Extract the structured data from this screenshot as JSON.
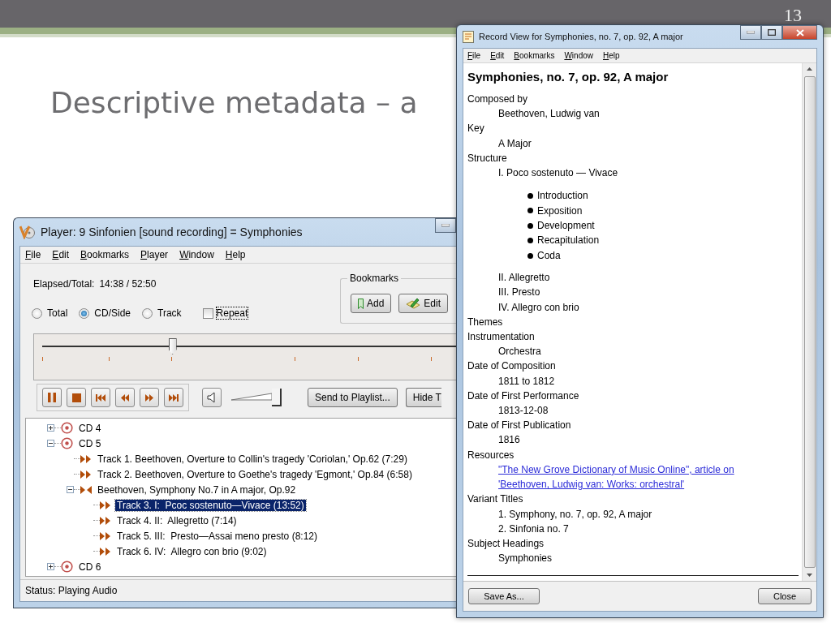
{
  "slide": {
    "title": "Descriptive metadata – a",
    "number": "13"
  },
  "player": {
    "title": "Player: 9 Sinfonien [sound recording] = Symphonies",
    "menu": [
      "File",
      "Edit",
      "Bookmarks",
      "Player",
      "Window",
      "Help"
    ],
    "elapsed_label": "Elapsed/Total:",
    "elapsed_value": "14:38 / 52:50",
    "time_modes": [
      {
        "label": "Total",
        "selected": false
      },
      {
        "label": "CD/Side",
        "selected": true
      },
      {
        "label": "Track",
        "selected": false
      }
    ],
    "repeat": {
      "label": "Repeat",
      "checked": false
    },
    "bookmarks": {
      "title": "Bookmarks",
      "buttons": [
        {
          "label": "Add",
          "kind": "add"
        },
        {
          "label": "Edit",
          "kind": "edit"
        }
      ]
    },
    "position": {
      "level": 0.315
    },
    "volume": {
      "level": 1
    },
    "buttons": [
      "Send to Playlist...",
      "Hide T"
    ],
    "tree": [
      {
        "label": "CD 4",
        "kind": "disc",
        "expanded": false,
        "selected": false
      },
      {
        "label": "CD 5",
        "kind": "disc",
        "expanded": true,
        "selected": false,
        "children": [
          {
            "label": "Track 1. Beethoven, Overture to Collin's tragedy 'Coriolan,' Op.62 (7:29)",
            "kind": "track",
            "selected": false
          },
          {
            "label": "Track 2. Beethoven, Overture to Goethe's tragedy 'Egmont,' Op.84 (6:58)",
            "kind": "track",
            "selected": false
          },
          {
            "label": "Beethoven, Symphony No.7 in A major, Op.92",
            "kind": "work",
            "expanded": true,
            "selected": false,
            "children": [
              {
                "label": "Track 3. I:  Pcoc sostenuto—Vivace (13:52)",
                "kind": "track",
                "selected": true
              },
              {
                "label": "Track 4. II:  Allegretto (7:14)",
                "kind": "track",
                "selected": false
              },
              {
                "label": "Track 5. III:  Presto—Assai meno presto (8:12)",
                "kind": "track",
                "selected": false
              },
              {
                "label": "Track 6. IV:  Allegro con brio (9:02)",
                "kind": "track",
                "selected": false
              }
            ]
          }
        ]
      },
      {
        "label": "CD 6",
        "kind": "disc",
        "expanded": false,
        "selected": false
      }
    ],
    "status": "Status: Playing Audio"
  },
  "record": {
    "title": "Record View for Symphonies, no. 7, op. 92, A major",
    "menu": [
      "File",
      "Edit",
      "Bookmarks",
      "Window",
      "Help"
    ],
    "heading": "Symphonies, no. 7, op. 92, A major",
    "fields": [
      {
        "label": "Composed by",
        "values": [
          {
            "text": "Beethoven, Ludwig van",
            "kind": "text"
          }
        ]
      },
      {
        "label": "Key",
        "values": [
          {
            "text": "A Major",
            "kind": "text"
          }
        ]
      },
      {
        "label": "Structure",
        "values": [
          {
            "text": "I. Poco sostenuto — Vivace",
            "kind": "text",
            "children": [
              {
                "text": "Introduction"
              },
              {
                "text": "Exposition"
              },
              {
                "text": "Development"
              },
              {
                "text": "Recapitulation"
              },
              {
                "text": "Coda"
              }
            ]
          },
          {
            "text": "II. Allegretto",
            "kind": "text"
          },
          {
            "text": "III. Presto",
            "kind": "text"
          },
          {
            "text": "IV. Allegro con brio",
            "kind": "text"
          }
        ]
      },
      {
        "label": "Themes"
      },
      {
        "label": "Instrumentation",
        "values": [
          {
            "text": "Orchestra",
            "kind": "text"
          }
        ]
      },
      {
        "label": "Date of Composition",
        "values": [
          {
            "text": "1811 to 1812",
            "kind": "text"
          }
        ]
      },
      {
        "label": "Date of First Performance",
        "values": [
          {
            "text": "1813-12-08",
            "kind": "text"
          }
        ]
      },
      {
        "label": "Date of First Publication",
        "values": [
          {
            "text": "1816",
            "kind": "text"
          }
        ]
      },
      {
        "label": "Resources",
        "values": [
          {
            "text": "\"The New Grove Dictionary of Music Online\", article on 'Beethoven, Ludwig van: Works: orchestral'",
            "kind": "link"
          }
        ]
      },
      {
        "label": "Variant Titles",
        "values": [
          {
            "text": "1. Symphony, no. 7, op. 92, A major",
            "kind": "text"
          },
          {
            "text": "2. Sinfonia no. 7",
            "kind": "text"
          }
        ]
      },
      {
        "label": "Subject Headings",
        "values": [
          {
            "text": "Symphonies",
            "kind": "text"
          }
        ]
      }
    ],
    "buttons": [
      "Save As...",
      "Close"
    ]
  }
}
